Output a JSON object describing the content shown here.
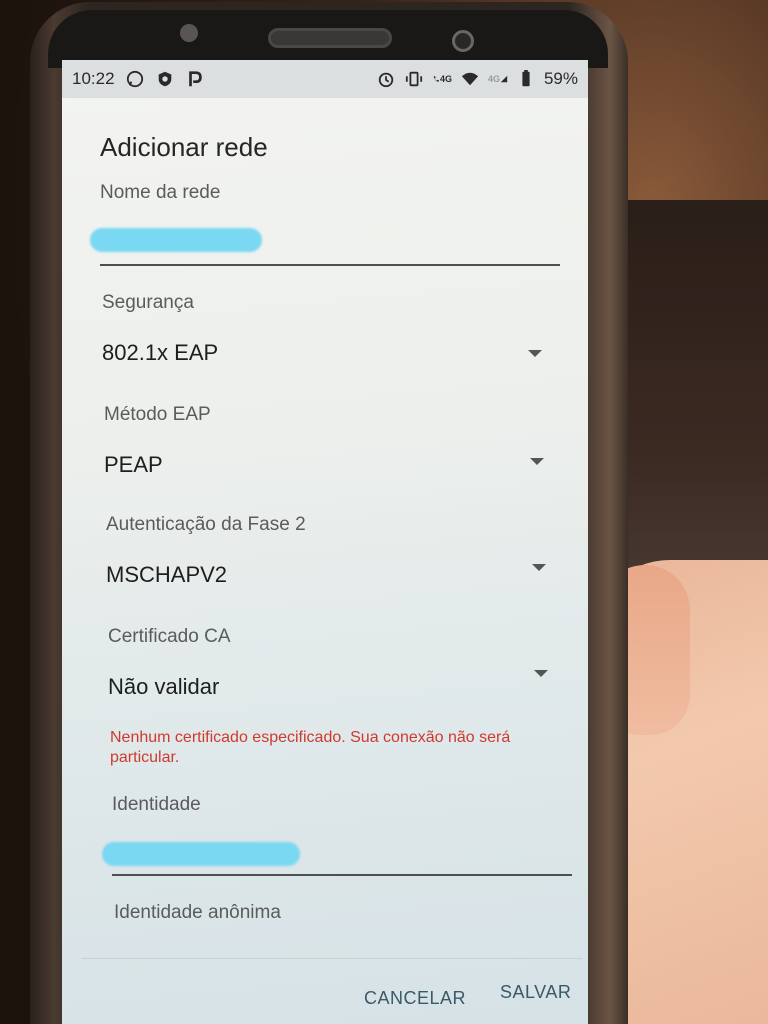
{
  "status_bar": {
    "time": "10:22",
    "left_icons": [
      "whatsapp-icon",
      "shield-icon",
      "p-app-icon"
    ],
    "right_icons": [
      "alarm-icon",
      "vibrate-icon",
      "volte-call-icon",
      "wifi-icon",
      "signal-icon",
      "battery-icon"
    ],
    "network_label_1": "4G",
    "network_label_2": "4G",
    "battery": "59%"
  },
  "dialog": {
    "title": "Adicionar rede",
    "network_name": {
      "label": "Nome da rede",
      "value": ""
    },
    "security": {
      "label": "Segurança",
      "value": "802.1x EAP"
    },
    "eap_method": {
      "label": "Método EAP",
      "value": "PEAP"
    },
    "phase2": {
      "label": "Autenticação da Fase 2",
      "value": "MSCHAPV2"
    },
    "ca_certificate": {
      "label": "Certificado CA",
      "value": "Não validar"
    },
    "warning": "Nenhum certificado especificado. Sua conexão não será particular.",
    "identity": {
      "label": "Identidade",
      "value": ""
    },
    "anonymous_identity": {
      "label": "Identidade anônima",
      "value": ""
    },
    "cancel_label": "CANCELAR",
    "save_label": "SALVAR"
  },
  "colors": {
    "accent": "#3a5a66",
    "warning": "#d03a2e",
    "redaction": "#7ad8f2"
  }
}
